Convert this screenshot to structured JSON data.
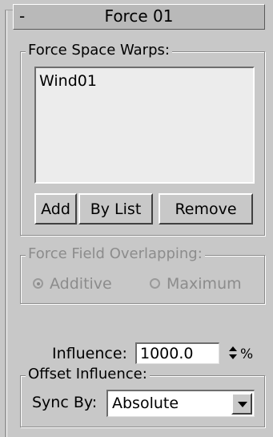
{
  "rollout": {
    "collapse_sign": "-",
    "title": "Force 01"
  },
  "force_space_warps": {
    "label": "Force Space Warps:",
    "items": [
      "Wind01"
    ],
    "add_label": "Add",
    "by_list_label": "By List",
    "remove_label": "Remove"
  },
  "force_field_overlapping": {
    "label": "Force Field Overlapping:",
    "enabled": false,
    "options": [
      "Additive",
      "Maximum"
    ],
    "selected": "Additive"
  },
  "influence": {
    "label": "Influence:",
    "value": "1000.0",
    "unit": "%"
  },
  "offset_influence": {
    "label": "Offset Influence:",
    "sync_by_label": "Sync By:",
    "sync_by_value": "Absolute"
  },
  "colors": {
    "panel_background": "#c8c8c8",
    "disabled_text": "#8c8c8c"
  }
}
